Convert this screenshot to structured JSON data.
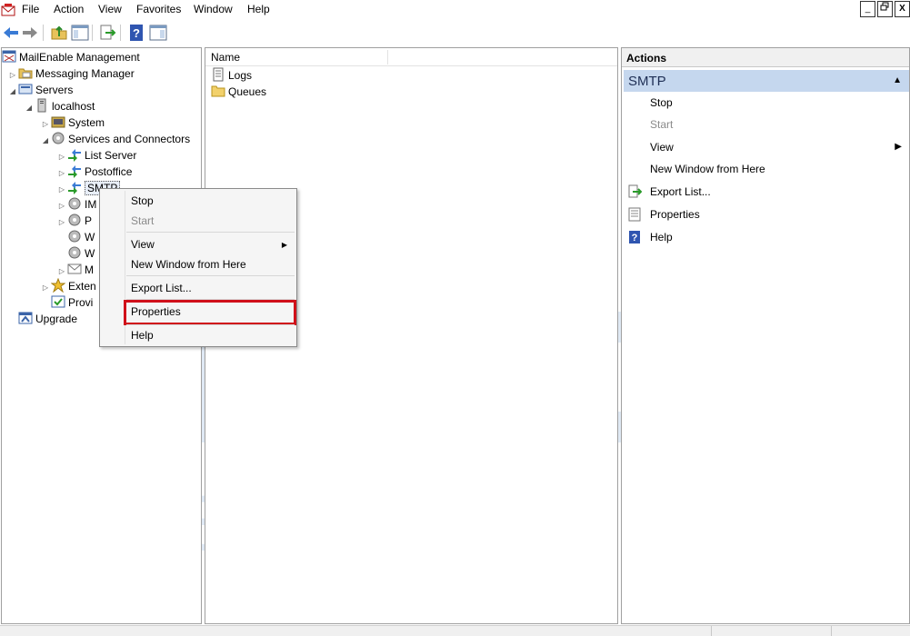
{
  "menubar": {
    "items": [
      "File",
      "Action",
      "View",
      "Favorites",
      "Window",
      "Help"
    ],
    "window_controls": [
      "_",
      "š",
      "X"
    ]
  },
  "toolbar": {
    "buttons": [
      "back-icon",
      "forward-icon",
      "up-folder-icon",
      "show-hide-tree-icon",
      "export-list-icon",
      "help-icon",
      "show-hide-action-pane-icon"
    ]
  },
  "tree": {
    "root": "MailEnable Management",
    "messaging_manager": "Messaging Manager",
    "servers": "Servers",
    "localhost": "localhost",
    "system": "System",
    "services": "Services and Connectors",
    "list_server": "List Server",
    "postoffice": "Postoffice",
    "smtp": "SMTP",
    "imap_partial": "IM",
    "pop_partial": "P",
    "w1_partial": "W",
    "w2_partial": "W",
    "m_partial": "M",
    "extensions_partial": "Exten",
    "provisioning_partial": "Provi",
    "upgrade": "Upgrade"
  },
  "list": {
    "column_name": "Name",
    "rows": [
      "Logs",
      "Queues"
    ]
  },
  "actions": {
    "title": "Actions",
    "section": "SMTP",
    "items": {
      "stop": "Stop",
      "start": "Start",
      "view": "View",
      "new_window": "New Window from Here",
      "export": "Export List...",
      "properties": "Properties",
      "help": "Help"
    }
  },
  "context_menu": {
    "stop": "Stop",
    "start": "Start",
    "view": "View",
    "new_window": "New Window from Here",
    "export": "Export List...",
    "properties": "Properties",
    "help": "Help",
    "highlight_color": "#d0101a"
  },
  "watermark": {
    "brand": "accu",
    "tagline": "web hosting",
    "color": "#dde8f3"
  }
}
